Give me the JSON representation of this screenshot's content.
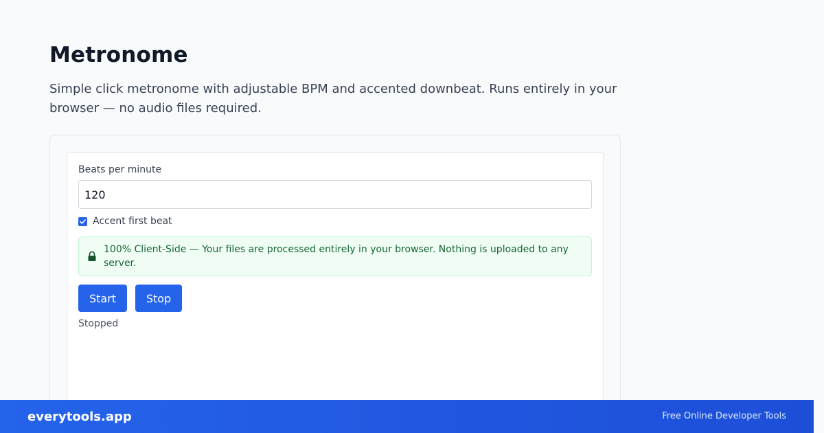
{
  "header": {
    "title": "Metronome",
    "description": "Simple click metronome with adjustable BPM and accented downbeat. Runs entirely in your browser — no audio files required."
  },
  "form": {
    "bpm_label": "Beats per minute",
    "bpm_value": "120",
    "accent_checked": true,
    "accent_label": "Accent first beat"
  },
  "notice": {
    "icon": "lock-icon",
    "text": "100% Client-Side — Your files are processed entirely in your browser. Nothing is uploaded to any server."
  },
  "controls": {
    "start_label": "Start",
    "stop_label": "Stop"
  },
  "status": {
    "text": "Stopped"
  },
  "footer": {
    "brand": "everytools.app",
    "tagline": "Free Online Developer Tools"
  },
  "colors": {
    "accent": "#2563eb",
    "notice_bg": "#f0fdf4",
    "notice_text": "#166534"
  }
}
